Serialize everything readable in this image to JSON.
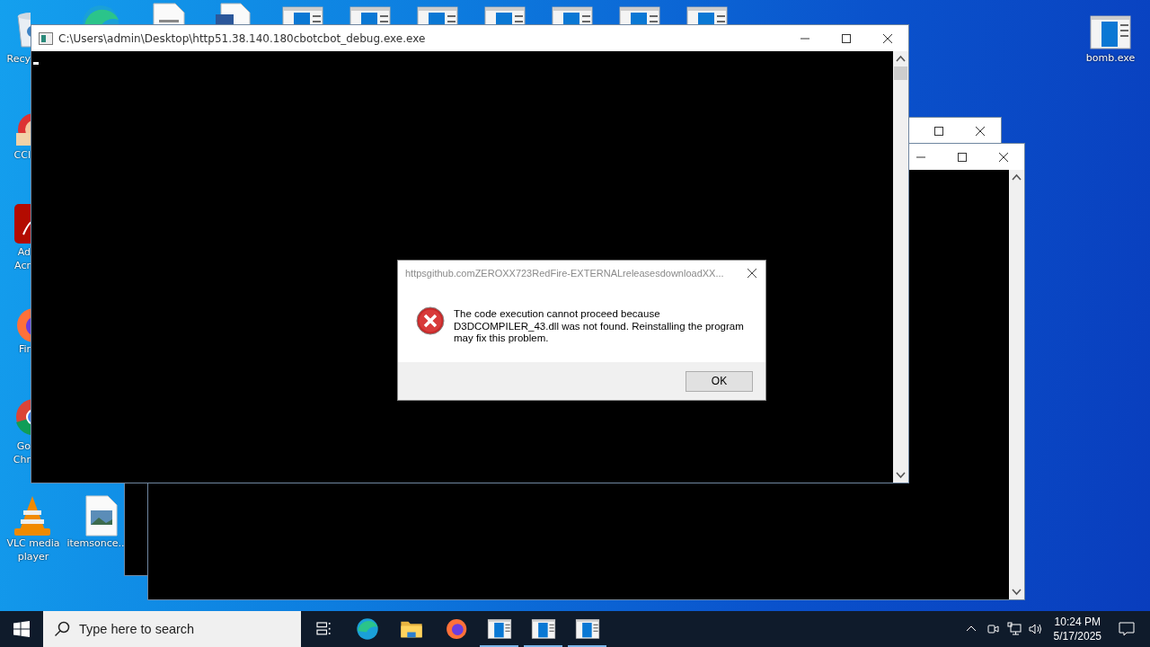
{
  "desktop": {
    "icons": [
      {
        "kind": "recycle",
        "label_lines": [
          "Recy"
        ]
      },
      {
        "kind": "ccleaner",
        "label_lines": [
          "CCl"
        ]
      },
      {
        "kind": "acrobat",
        "label_lines": [
          "Ad",
          "Acr"
        ]
      },
      {
        "kind": "firefox",
        "label_lines": [
          "Fir"
        ]
      },
      {
        "kind": "chrome",
        "label_lines": [
          "Go",
          "Chr"
        ]
      },
      {
        "kind": "vlc",
        "label_lines": [
          "VLC media",
          "player"
        ]
      },
      {
        "kind": "image",
        "label_lines": [
          "itemsonce.."
        ]
      },
      {
        "kind": "console",
        "label_lines": [
          "bomb.exe"
        ]
      }
    ],
    "top_icons": [
      {
        "kind": "edge"
      },
      {
        "kind": "document"
      },
      {
        "kind": "word"
      },
      {
        "kind": "console"
      },
      {
        "kind": "console"
      },
      {
        "kind": "console"
      },
      {
        "kind": "console"
      },
      {
        "kind": "console"
      },
      {
        "kind": "console"
      },
      {
        "kind": "console"
      }
    ]
  },
  "windows": [
    {
      "controls": [
        {
          "kind": "maximize"
        },
        {
          "kind": "close"
        }
      ],
      "scrollbar": false,
      "cursor": false
    },
    {
      "controls": [
        {
          "kind": "minimize"
        },
        {
          "kind": "maximize"
        },
        {
          "kind": "close"
        }
      ],
      "scrollbar": true,
      "cursor": false
    },
    {
      "title": "C:\\Users\\admin\\Desktop\\http51.38.140.180cbotcbot_debug.exe.exe",
      "controls": [
        {
          "kind": "minimize"
        },
        {
          "kind": "maximize"
        },
        {
          "kind": "close"
        }
      ],
      "scrollbar": true,
      "cursor": true
    }
  ],
  "dialog": {
    "title": "httpsgithub.comZEROXX723RedFire-EXTERNALreleasesdownloadXX...",
    "message": "The code execution cannot proceed because D3DCOMPILER_43.dll was not found. Reinstalling the program may fix this problem.",
    "button": "OK"
  },
  "taskbar": {
    "search": {
      "placeholder": "Type here to search"
    },
    "apps": [
      {
        "kind": "taskview",
        "running": false
      },
      {
        "kind": "edge",
        "running": false
      },
      {
        "kind": "folder",
        "running": false
      },
      {
        "kind": "firefox",
        "running": false
      },
      {
        "kind": "console",
        "running": true
      },
      {
        "kind": "console",
        "running": true
      },
      {
        "kind": "console",
        "running": true
      }
    ],
    "clock": {
      "time": "10:24 PM",
      "date": "5/17/2025"
    }
  }
}
